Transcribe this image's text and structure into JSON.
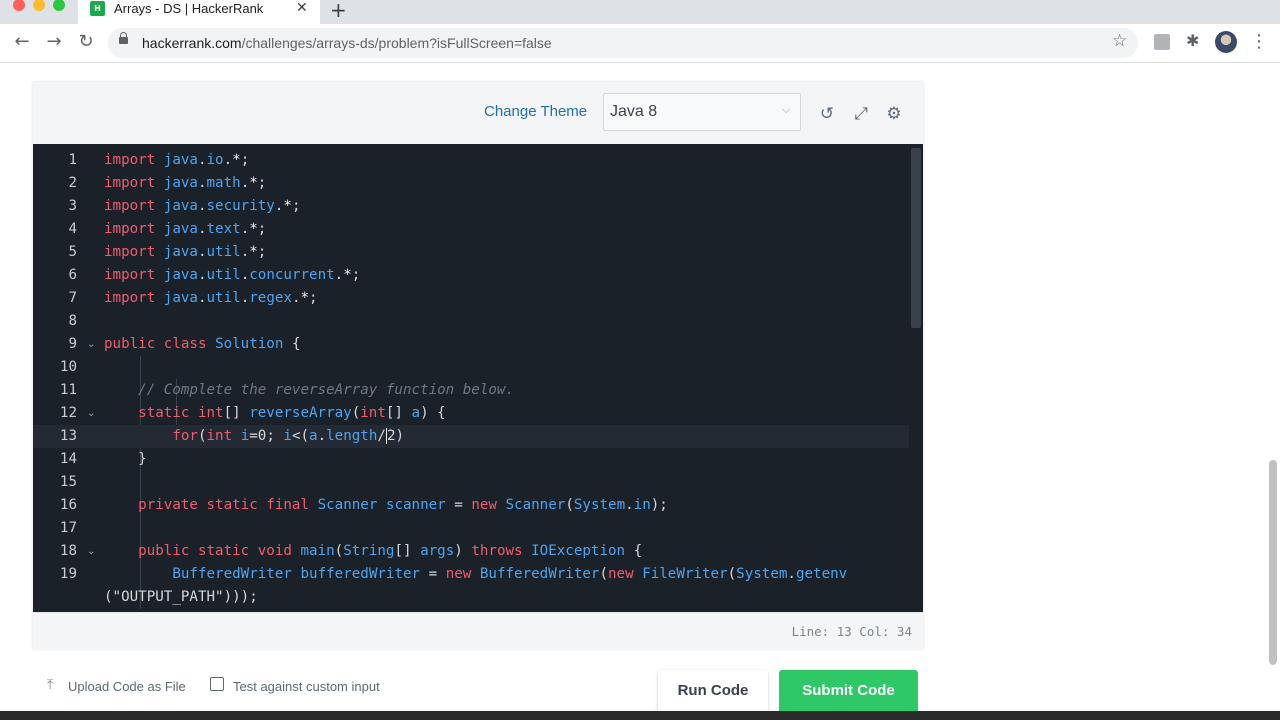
{
  "browser": {
    "tab_title": "Arrays - DS | HackerRank",
    "favicon_text": "H",
    "url_host": "hackerrank.com",
    "url_path": "/challenges/arrays-ds/problem?isFullScreen=false",
    "close_glyph": "✕",
    "new_tab_glyph": "+",
    "back_glyph": "←",
    "forward_glyph": "→",
    "reload_glyph": "↻",
    "star_glyph": "☆",
    "puzzle_glyph": "✱",
    "menu_glyph": "⋮"
  },
  "editor": {
    "change_theme_label": "Change Theme",
    "language": "Java 8",
    "chevron_glyph": "⌵",
    "history_icon_glyph": "↺",
    "fullscreen_icon_glyph": "⤢",
    "settings_icon_glyph": "⚙",
    "status": "Line: 13 Col: 34",
    "fold_glyph": "⌄",
    "lines": [
      {
        "n": "1",
        "fold": "",
        "tokens": [
          [
            "kw",
            "import"
          ],
          [
            "pl",
            " "
          ],
          [
            "ty",
            "java"
          ],
          [
            "pl",
            "."
          ],
          [
            "ty",
            "io"
          ],
          [
            "pl",
            "."
          ],
          [
            "st",
            "*"
          ],
          [
            "pl",
            ";"
          ]
        ]
      },
      {
        "n": "2",
        "fold": "",
        "tokens": [
          [
            "kw",
            "import"
          ],
          [
            "pl",
            " "
          ],
          [
            "ty",
            "java"
          ],
          [
            "pl",
            "."
          ],
          [
            "ty",
            "math"
          ],
          [
            "pl",
            "."
          ],
          [
            "st",
            "*"
          ],
          [
            "pl",
            ";"
          ]
        ]
      },
      {
        "n": "3",
        "fold": "",
        "tokens": [
          [
            "kw",
            "import"
          ],
          [
            "pl",
            " "
          ],
          [
            "ty",
            "java"
          ],
          [
            "pl",
            "."
          ],
          [
            "ty",
            "security"
          ],
          [
            "pl",
            "."
          ],
          [
            "st",
            "*"
          ],
          [
            "pl",
            ";"
          ]
        ]
      },
      {
        "n": "4",
        "fold": "",
        "tokens": [
          [
            "kw",
            "import"
          ],
          [
            "pl",
            " "
          ],
          [
            "ty",
            "java"
          ],
          [
            "pl",
            "."
          ],
          [
            "ty",
            "text"
          ],
          [
            "pl",
            "."
          ],
          [
            "st",
            "*"
          ],
          [
            "pl",
            ";"
          ]
        ]
      },
      {
        "n": "5",
        "fold": "",
        "tokens": [
          [
            "kw",
            "import"
          ],
          [
            "pl",
            " "
          ],
          [
            "ty",
            "java"
          ],
          [
            "pl",
            "."
          ],
          [
            "ty",
            "util"
          ],
          [
            "pl",
            "."
          ],
          [
            "st",
            "*"
          ],
          [
            "pl",
            ";"
          ]
        ]
      },
      {
        "n": "6",
        "fold": "",
        "tokens": [
          [
            "kw",
            "import"
          ],
          [
            "pl",
            " "
          ],
          [
            "ty",
            "java"
          ],
          [
            "pl",
            "."
          ],
          [
            "ty",
            "util"
          ],
          [
            "pl",
            "."
          ],
          [
            "ty",
            "concurrent"
          ],
          [
            "pl",
            "."
          ],
          [
            "st",
            "*"
          ],
          [
            "pl",
            ";"
          ]
        ]
      },
      {
        "n": "7",
        "fold": "",
        "tokens": [
          [
            "kw",
            "import"
          ],
          [
            "pl",
            " "
          ],
          [
            "ty",
            "java"
          ],
          [
            "pl",
            "."
          ],
          [
            "ty",
            "util"
          ],
          [
            "pl",
            "."
          ],
          [
            "ty",
            "regex"
          ],
          [
            "pl",
            "."
          ],
          [
            "st",
            "*"
          ],
          [
            "pl",
            ";"
          ]
        ]
      },
      {
        "n": "8",
        "fold": "",
        "tokens": []
      },
      {
        "n": "9",
        "fold": "v",
        "tokens": [
          [
            "kw",
            "public"
          ],
          [
            "pl",
            " "
          ],
          [
            "kw",
            "class"
          ],
          [
            "pl",
            " "
          ],
          [
            "ty",
            "Solution"
          ],
          [
            "pl",
            " {"
          ]
        ]
      },
      {
        "n": "10",
        "fold": "",
        "tokens": []
      },
      {
        "n": "11",
        "fold": "",
        "tokens": [
          [
            "pl",
            "    "
          ],
          [
            "cm",
            "// Complete the reverseArray function below."
          ]
        ]
      },
      {
        "n": "12",
        "fold": "v",
        "tokens": [
          [
            "pl",
            "    "
          ],
          [
            "kw",
            "static"
          ],
          [
            "pl",
            " "
          ],
          [
            "kw",
            "int"
          ],
          [
            "pl",
            "[] "
          ],
          [
            "ty",
            "reverseArray"
          ],
          [
            "pl",
            "("
          ],
          [
            "kw",
            "int"
          ],
          [
            "pl",
            "[] "
          ],
          [
            "ty",
            "a"
          ],
          [
            "pl",
            ") {"
          ]
        ]
      },
      {
        "n": "13",
        "fold": "",
        "active": true,
        "tokens": [
          [
            "pl",
            "        "
          ],
          [
            "kw",
            "for"
          ],
          [
            "pl",
            "("
          ],
          [
            "kw",
            "int"
          ],
          [
            "pl",
            " "
          ],
          [
            "ty",
            "i"
          ],
          [
            "pl",
            "=0; "
          ],
          [
            "ty",
            "i"
          ],
          [
            "pl",
            "<("
          ],
          [
            "ty",
            "a"
          ],
          [
            "pl",
            "."
          ],
          [
            "ty",
            "length"
          ],
          [
            "pl",
            "/"
          ],
          [
            "cur",
            ""
          ],
          [
            "pl",
            "2)"
          ]
        ]
      },
      {
        "n": "14",
        "fold": "",
        "tokens": [
          [
            "pl",
            "    }"
          ]
        ]
      },
      {
        "n": "15",
        "fold": "",
        "tokens": []
      },
      {
        "n": "16",
        "fold": "",
        "tokens": [
          [
            "pl",
            "    "
          ],
          [
            "kw",
            "private"
          ],
          [
            "pl",
            " "
          ],
          [
            "kw",
            "static"
          ],
          [
            "pl",
            " "
          ],
          [
            "kw",
            "final"
          ],
          [
            "pl",
            " "
          ],
          [
            "ty",
            "Scanner"
          ],
          [
            "pl",
            " "
          ],
          [
            "ty",
            "scanner"
          ],
          [
            "pl",
            " = "
          ],
          [
            "kw",
            "new"
          ],
          [
            "pl",
            " "
          ],
          [
            "ty",
            "Scanner"
          ],
          [
            "pl",
            "("
          ],
          [
            "ty",
            "System"
          ],
          [
            "pl",
            "."
          ],
          [
            "ty",
            "in"
          ],
          [
            "pl",
            ");"
          ]
        ]
      },
      {
        "n": "17",
        "fold": "",
        "tokens": []
      },
      {
        "n": "18",
        "fold": "v",
        "tokens": [
          [
            "pl",
            "    "
          ],
          [
            "kw",
            "public"
          ],
          [
            "pl",
            " "
          ],
          [
            "kw",
            "static"
          ],
          [
            "pl",
            " "
          ],
          [
            "kw",
            "void"
          ],
          [
            "pl",
            " "
          ],
          [
            "ty",
            "main"
          ],
          [
            "pl",
            "("
          ],
          [
            "ty",
            "String"
          ],
          [
            "pl",
            "[] "
          ],
          [
            "ty",
            "args"
          ],
          [
            "pl",
            ") "
          ],
          [
            "kw",
            "throws"
          ],
          [
            "pl",
            " "
          ],
          [
            "ty",
            "IOException"
          ],
          [
            "pl",
            " {"
          ]
        ]
      },
      {
        "n": "19",
        "fold": "",
        "tokens": [
          [
            "pl",
            "        "
          ],
          [
            "ty",
            "BufferedWriter"
          ],
          [
            "pl",
            " "
          ],
          [
            "ty",
            "bufferedWriter"
          ],
          [
            "pl",
            " = "
          ],
          [
            "kw",
            "new"
          ],
          [
            "pl",
            " "
          ],
          [
            "ty",
            "BufferedWriter"
          ],
          [
            "pl",
            "("
          ],
          [
            "kw",
            "new"
          ],
          [
            "pl",
            " "
          ],
          [
            "ty",
            "FileWriter"
          ],
          [
            "pl",
            "("
          ],
          [
            "ty",
            "System"
          ],
          [
            "pl",
            "."
          ],
          [
            "ty",
            "getenv"
          ]
        ]
      },
      {
        "n": "",
        "fold": "",
        "tokens": [
          [
            "pl",
            "(\"OUTPUT_PATH\")));"
          ]
        ]
      }
    ]
  },
  "footer": {
    "upload_label": "Upload Code as File",
    "upload_glyph": "⤒",
    "custom_input_label": "Test against custom input",
    "run_label": "Run Code",
    "submit_label": "Submit Code"
  }
}
